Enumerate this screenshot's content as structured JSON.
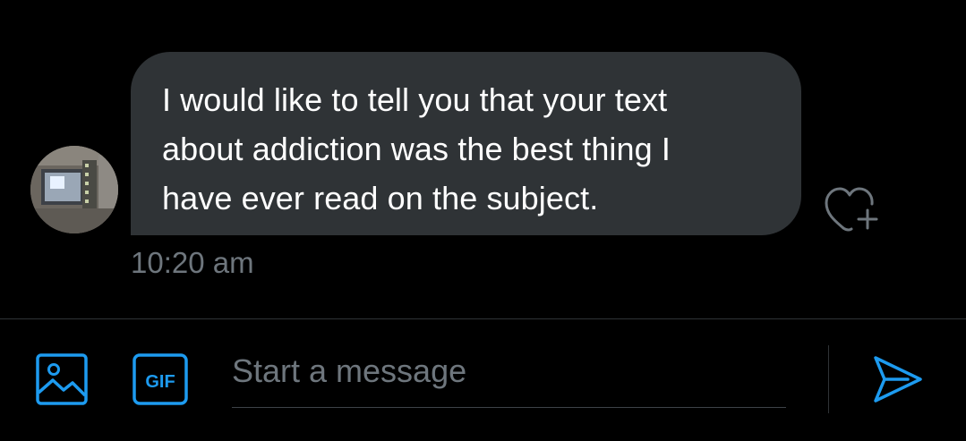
{
  "conversation": {
    "messages": [
      {
        "text": "I would like to tell you that your text about addiction was the best thing I have ever read on the subject.",
        "lines": [
          "I would like to tell you that your text",
          "about addiction was the best thing I",
          "have ever read on the subject."
        ],
        "time": "10:20 am",
        "sender": "other"
      }
    ]
  },
  "icons": {
    "avatar": "avatar",
    "react": "heart-plus-icon",
    "media": "image-icon",
    "gif": "gif-icon",
    "send": "send-icon"
  },
  "composer": {
    "placeholder": "Start a message",
    "value": "",
    "gif_label": "GIF"
  },
  "colors": {
    "background": "#000000",
    "bubble": "#2f3336",
    "accent": "#1d9bf0",
    "muted_text": "#6e767d",
    "text": "#ffffff"
  }
}
